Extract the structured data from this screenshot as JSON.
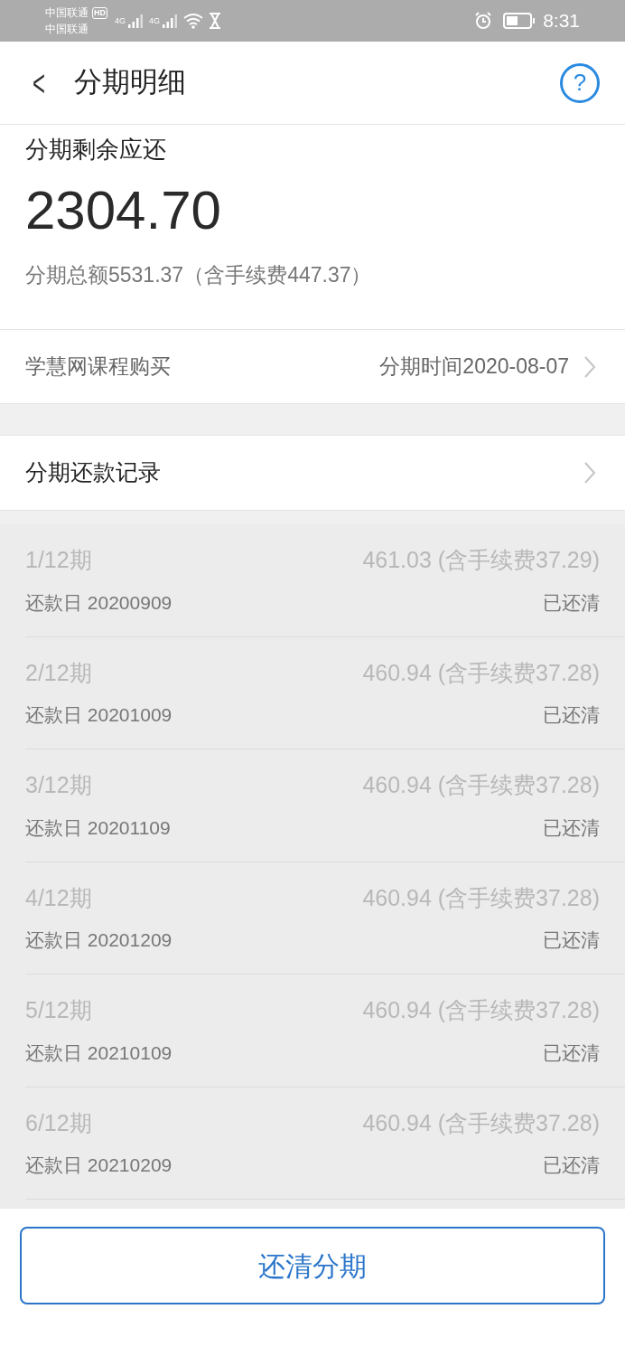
{
  "status_bar": {
    "carrier_1": "中国联通",
    "hd": "HD",
    "carrier_2": "中国联通",
    "network_1": "4G",
    "network_2": "4G",
    "time": "8:31"
  },
  "header": {
    "back": "<",
    "title": "分期明细",
    "help": "?"
  },
  "summary": {
    "label": "分期剩余应还",
    "amount": "2304.70",
    "total": "分期总额5531.37（含手续费447.37）"
  },
  "purchase": {
    "name": "学慧网课程购买",
    "date": "分期时间2020-08-07"
  },
  "records_link": {
    "label": "分期还款记录"
  },
  "installments": [
    {
      "period": "1/12期",
      "amount": "461.03 (含手续费37.29)",
      "due": "还款日 20200909",
      "status": "已还清"
    },
    {
      "period": "2/12期",
      "amount": "460.94 (含手续费37.28)",
      "due": "还款日 20201009",
      "status": "已还清"
    },
    {
      "period": "3/12期",
      "amount": "460.94 (含手续费37.28)",
      "due": "还款日 20201109",
      "status": "已还清"
    },
    {
      "period": "4/12期",
      "amount": "460.94 (含手续费37.28)",
      "due": "还款日 20201209",
      "status": "已还清"
    },
    {
      "period": "5/12期",
      "amount": "460.94 (含手续费37.28)",
      "due": "还款日 20210109",
      "status": "已还清"
    },
    {
      "period": "6/12期",
      "amount": "460.94 (含手续费37.28)",
      "due": "还款日 20210209",
      "status": "已还清"
    }
  ],
  "action_button": "还清分期"
}
